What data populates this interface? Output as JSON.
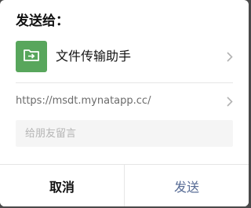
{
  "dialog": {
    "title": "发送给：",
    "recipient": {
      "name": "文件传输助手",
      "avatar_icon": "file-transfer-icon",
      "avatar_color": "#58a65c"
    },
    "link": {
      "url": "https://msdt.mynatapp.cc/"
    },
    "message": {
      "placeholder": "给朋友留言",
      "value": ""
    },
    "buttons": {
      "cancel_label": "取消",
      "send_label": "发送"
    },
    "colors": {
      "send_accent": "#576b95"
    }
  }
}
